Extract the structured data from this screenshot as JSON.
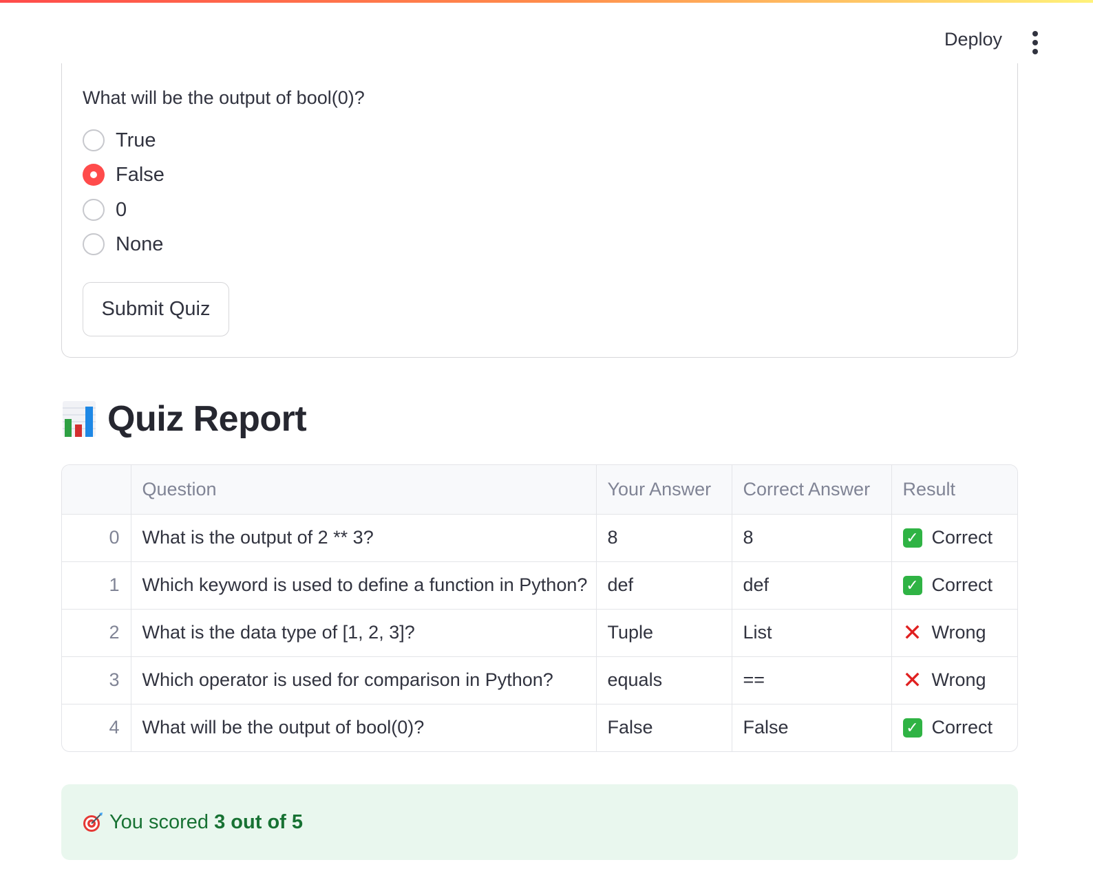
{
  "header": {
    "deploy_label": "Deploy",
    "menu_icon": "kebab-menu-icon"
  },
  "quiz": {
    "question": "What will be the output of bool(0)?",
    "options": [
      "True",
      "False",
      "0",
      "None"
    ],
    "selected": "False",
    "submit_label": "Submit Quiz"
  },
  "report": {
    "icon": "bar-chart-icon",
    "title": "Quiz Report",
    "columns": [
      "",
      "Question",
      "Your Answer",
      "Correct Answer",
      "Result"
    ],
    "rows": [
      {
        "index": "0",
        "question": "What is the output of 2 ** 3?",
        "your_answer": "8",
        "correct_answer": "8",
        "result": "Correct",
        "result_icon": "check-mark-icon"
      },
      {
        "index": "1",
        "question": "Which keyword is used to define a function in Python?",
        "your_answer": "def",
        "correct_answer": "def",
        "result": "Correct",
        "result_icon": "check-mark-icon"
      },
      {
        "index": "2",
        "question": "What is the data type of [1, 2, 3]?",
        "your_answer": "Tuple",
        "correct_answer": "List",
        "result": "Wrong",
        "result_icon": "cross-mark-icon"
      },
      {
        "index": "3",
        "question": "Which operator is used for comparison in Python?",
        "your_answer": "equals",
        "correct_answer": "==",
        "result": "Wrong",
        "result_icon": "cross-mark-icon"
      },
      {
        "index": "4",
        "question": "What will be the output of bool(0)?",
        "your_answer": "False",
        "correct_answer": "False",
        "result": "Correct",
        "result_icon": "check-mark-icon"
      }
    ]
  },
  "score": {
    "icon": "target-icon",
    "prefix": "You scored ",
    "value": "3 out of 5"
  },
  "colors": {
    "accent": "#ff4b4b",
    "success_bg": "#e9f7ee",
    "success_text": "#177233"
  }
}
